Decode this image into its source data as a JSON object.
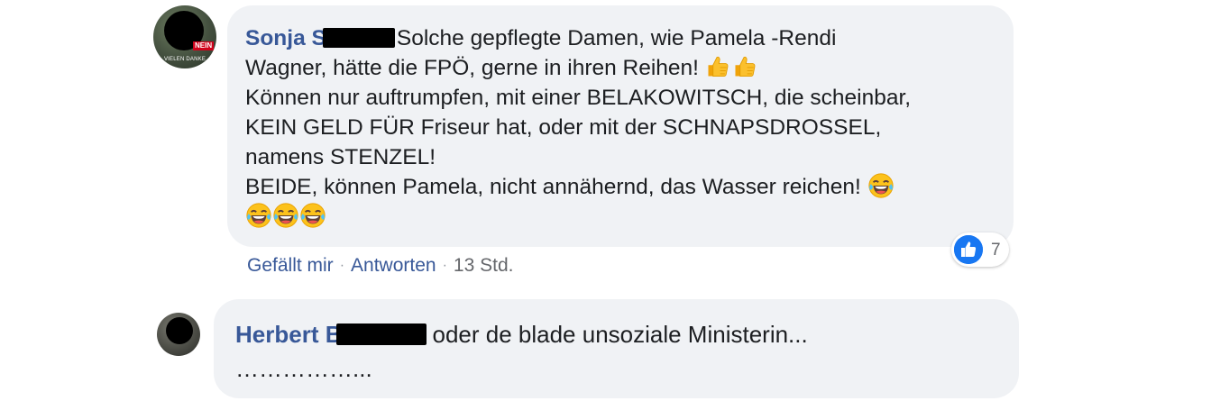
{
  "comments": [
    {
      "author_visible": "Sonja S",
      "avatar": {
        "badge": "NEIN",
        "caption": "VIELEN DANKE"
      },
      "lines": [
        "Solche gepflegte Damen, wie Pamela -Rendi",
        "Wagner, hätte die FPÖ, gerne in ihren Reihen!",
        "Können nur auftrumpfen, mit einer BELAKOWITSCH, die scheinbar,",
        "KEIN GELD FÜR Friseur hat, oder mit der SCHNAPSDROSSEL,",
        "namens STENZEL!",
        "BEIDE, können Pamela, nicht annähernd, das Wasser reichen!"
      ],
      "emoji_line2": [
        "thumbs-up",
        "thumbs-up"
      ],
      "emoji_line6": [
        "laughing-tears"
      ],
      "emoji_line7": [
        "laughing-tears",
        "laughing-tears",
        "laughing-tears"
      ],
      "reactions": {
        "icon": "like-icon",
        "count": "7"
      },
      "actions": {
        "like": "Gefällt mir",
        "reply": "Antworten",
        "separator": "·",
        "time": "13 Std."
      }
    },
    {
      "author_visible": "Herbert B",
      "lines": [
        "oder de blade unsoziale Ministerin...",
        "……………..."
      ]
    }
  ],
  "colors": {
    "author": "#385898",
    "bubble": "#f0f2f5",
    "meta": "#65676b",
    "like_badge": "#1877f2"
  }
}
